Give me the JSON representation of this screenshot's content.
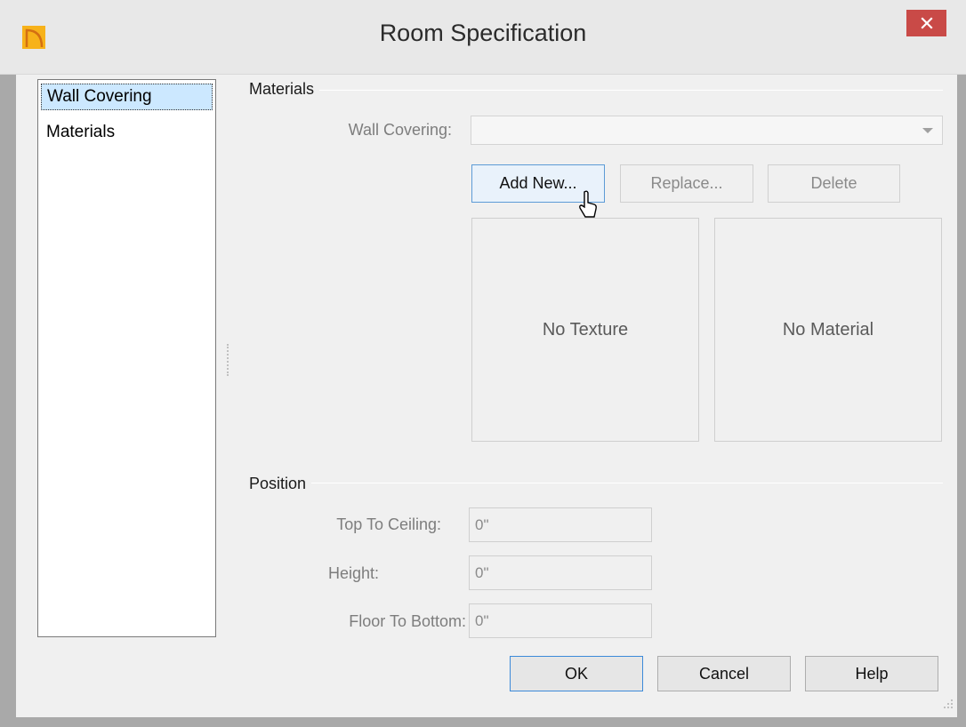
{
  "window": {
    "title": "Room Specification",
    "icon": "app-logo-icon",
    "close_icon": "close-icon"
  },
  "nav": {
    "items": [
      {
        "label": "Wall Covering",
        "selected": true
      },
      {
        "label": "Materials",
        "selected": false
      }
    ]
  },
  "materials": {
    "group_title": "Materials",
    "wall_covering_label": "Wall Covering:",
    "wall_covering_value": "",
    "add_new_label": "Add New...",
    "replace_label": "Replace...",
    "delete_label": "Delete",
    "texture_preview": "No Texture",
    "material_preview": "No Material"
  },
  "position": {
    "group_title": "Position",
    "top_to_ceiling_label": "Top To Ceiling:",
    "top_to_ceiling_value": "0\"",
    "height_label": "Height:",
    "height_value": "0\"",
    "floor_to_bottom_label": "Floor To Bottom:",
    "floor_to_bottom_value": "0\""
  },
  "footer": {
    "ok_label": "OK",
    "cancel_label": "Cancel",
    "help_label": "Help"
  },
  "colors": {
    "close_button": "#c94a47",
    "selection": "#cce8ff",
    "focus_border": "#3c8ad9"
  }
}
